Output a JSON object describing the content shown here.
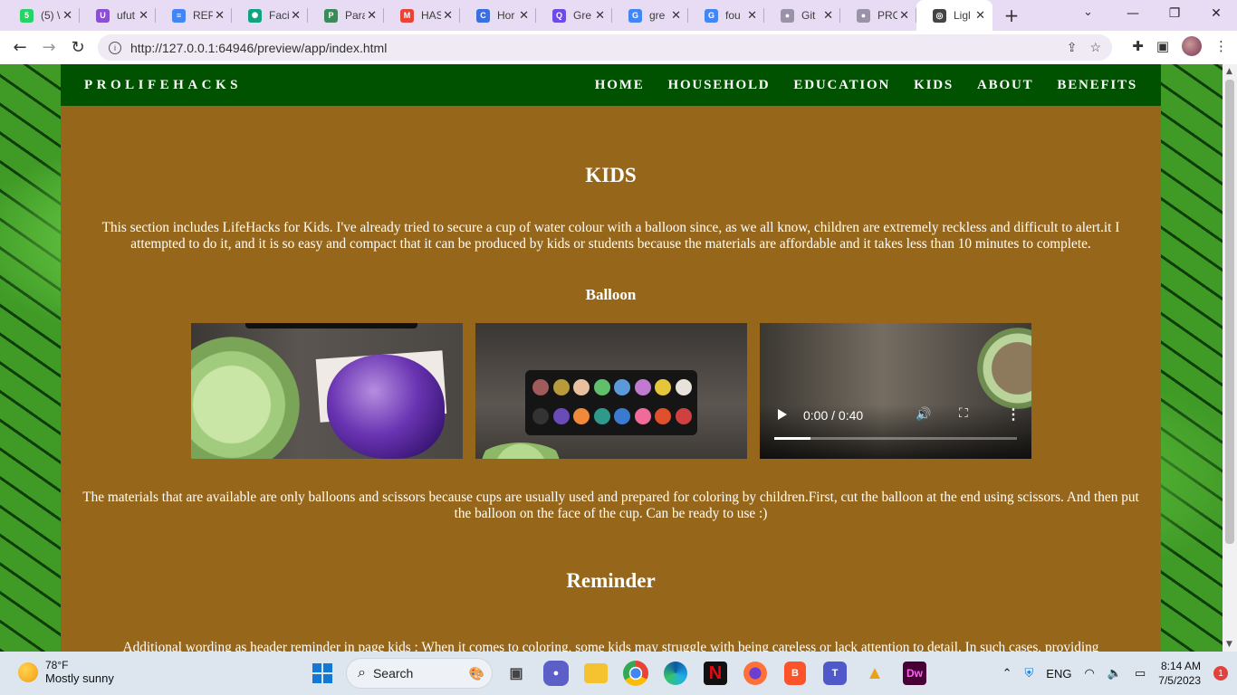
{
  "browser": {
    "tabs": [
      {
        "title": "(5) \\",
        "favicon_color": "#25d366",
        "favicon_glyph": "5",
        "active": false
      },
      {
        "title": "ufut",
        "favicon_color": "#8b4fd1",
        "favicon_glyph": "U",
        "active": false
      },
      {
        "title": "REP",
        "favicon_color": "#4285f4",
        "favicon_glyph": "≡",
        "active": false
      },
      {
        "title": "Faci",
        "favicon_color": "#10a37f",
        "favicon_glyph": "✺",
        "active": false
      },
      {
        "title": "Para",
        "favicon_color": "#3c8a5a",
        "favicon_glyph": "P",
        "active": false
      },
      {
        "title": "HAS",
        "favicon_color": "#ea4335",
        "favicon_glyph": "M",
        "active": false
      },
      {
        "title": "Hor",
        "favicon_color": "#3b6fe0",
        "favicon_glyph": "C",
        "active": false
      },
      {
        "title": "Gre",
        "favicon_color": "#6d4ce6",
        "favicon_glyph": "Q",
        "active": false
      },
      {
        "title": "gre",
        "favicon_color": "#4285f4",
        "favicon_glyph": "G",
        "active": false
      },
      {
        "title": "fou",
        "favicon_color": "#4285f4",
        "favicon_glyph": "G",
        "active": false
      },
      {
        "title": "Git",
        "favicon_color": "#9a92a6",
        "favicon_glyph": "●",
        "active": false
      },
      {
        "title": "PRC",
        "favicon_color": "#9a92a6",
        "favicon_glyph": "●",
        "active": false
      },
      {
        "title": "Ligl",
        "favicon_color": "#444444",
        "favicon_glyph": "◎",
        "active": true
      }
    ],
    "url": "http://127.0.0.1:64946/preview/app/index.html"
  },
  "site": {
    "brand": "PROLIFEHACKS",
    "nav": [
      "HOME",
      "HOUSEHOLD",
      "EDUCATION",
      "KIDS",
      "ABOUT",
      "BENEFITS"
    ],
    "colors": {
      "nav_bg": "#005200",
      "content_bg": "#96671b"
    },
    "heading": "KIDS",
    "intro": "This section includes LifeHacks for Kids. I've already tried to secure a cup of water colour with a balloon since, as we all know, children are extremely reckless and difficult to alert.it I attempted to do it, and it is so easy and compact that it can be produced by kids or students because the materials are affordable and it takes less than 10 minutes to complete.",
    "subheading": "Balloon",
    "video": {
      "time": "0:00 / 0:40",
      "progress_fraction": 0.15
    },
    "materials": "The materials that are available are only balloons and scissors because cups are usually used and prepared for coloring by children.First, cut the balloon at the end using scissors. And then put the balloon on the face of the cup. Can be ready to use :)",
    "reminder_heading": "Reminder",
    "reminder_text": "Additional wording as header reminder in page kids : When it comes to coloring, some kids may struggle with being careless or lack attention to detail. In such cases, providing"
  },
  "taskbar": {
    "weather_temp": "78°F",
    "weather_desc": "Mostly sunny",
    "search_label": "Search",
    "language": "ENG",
    "time": "8:14 AM",
    "date": "7/5/2023",
    "notifications": "1"
  }
}
